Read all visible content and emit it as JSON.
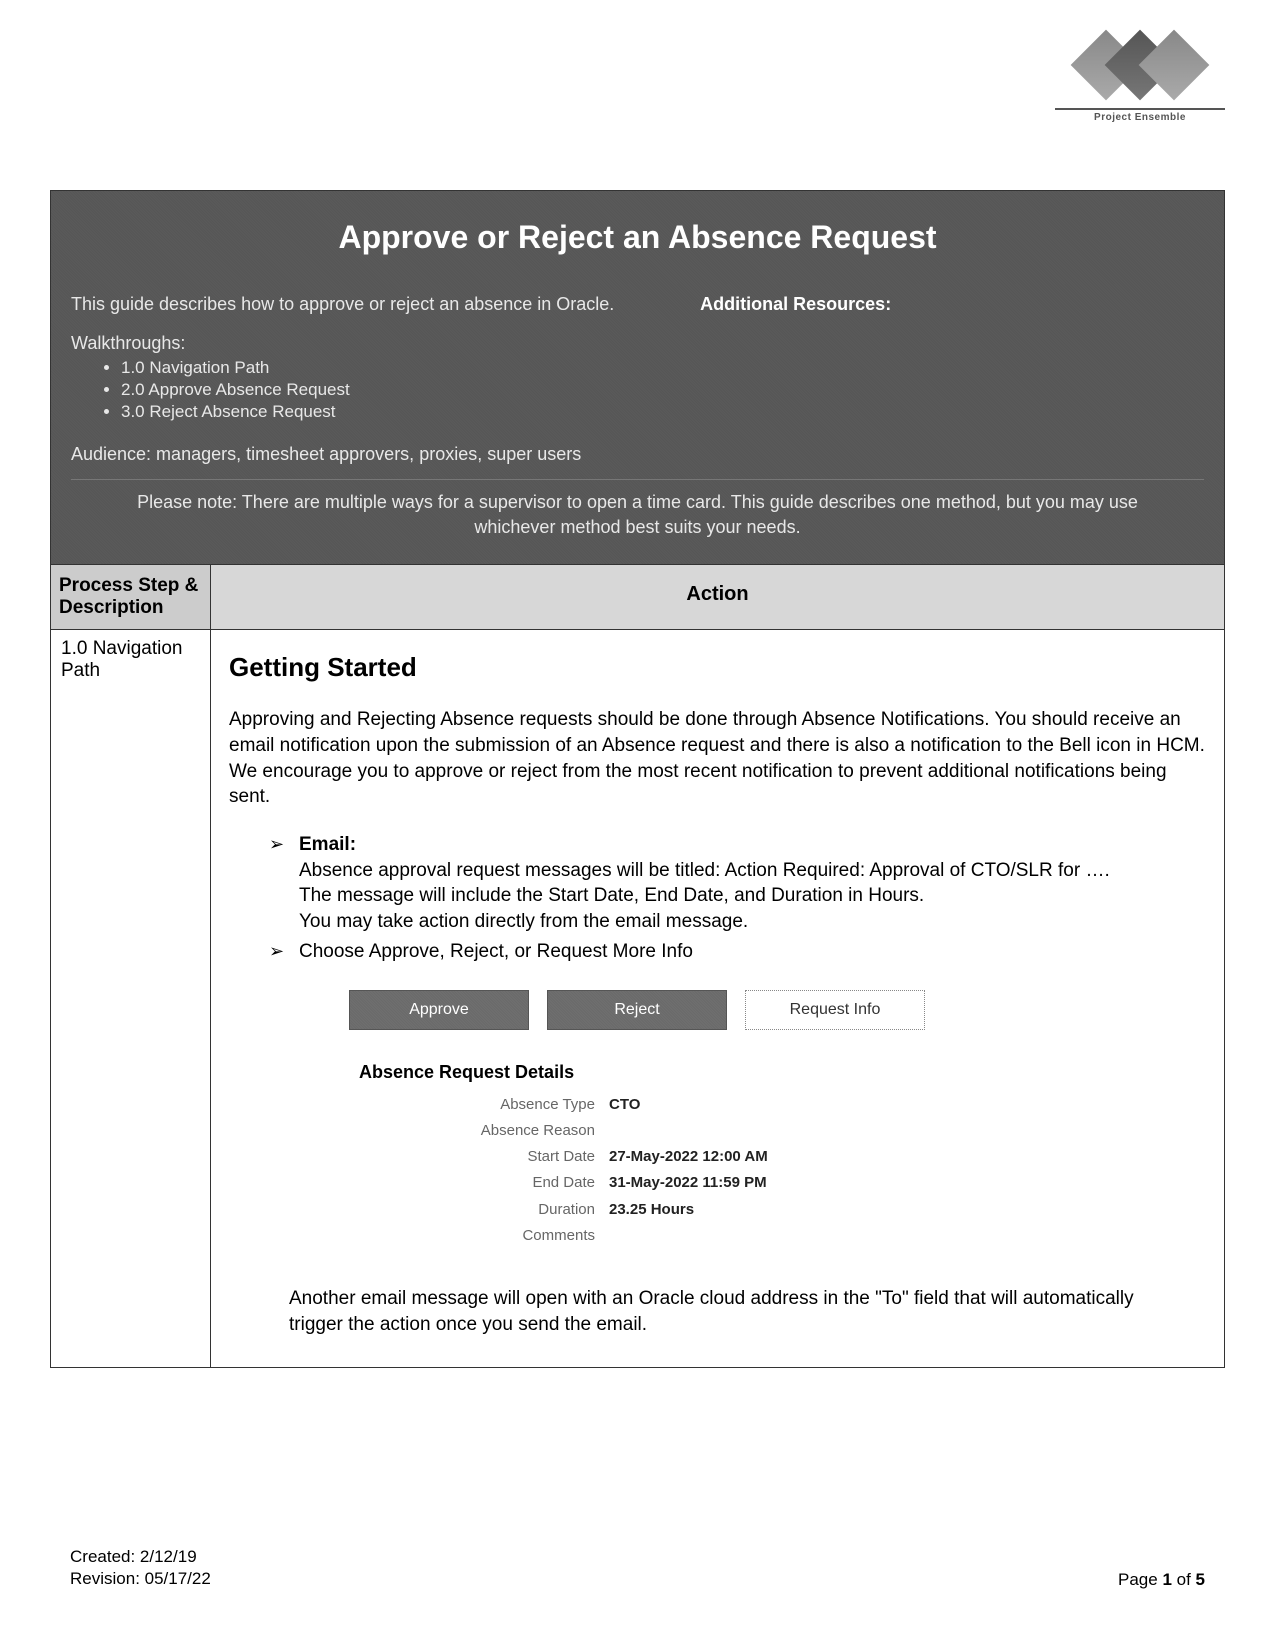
{
  "logo": {
    "caption": "Project Ensemble"
  },
  "title": "Approve or Reject an Absence Request",
  "intro": {
    "desc": "This guide describes how to approve or reject an absence in Oracle.",
    "walk_title": "Walkthroughs:",
    "walkthroughs": [
      "1.0 Navigation Path",
      "2.0 Approve Absence Request",
      "3.0 Reject Absence Request"
    ],
    "audience": "Audience: managers, timesheet approvers, proxies, super users",
    "resources_title": "Additional Resources:",
    "note": "Please note: There are multiple ways for a supervisor to open a time card. This guide describes one method, but you may use whichever method best suits your needs."
  },
  "table": {
    "header_left": "Process Step & Description",
    "header_right": "Action",
    "row1": {
      "step": "1.0 Navigation Path",
      "heading": "Getting Started",
      "para1": "Approving and Rejecting Absence requests should be done through Absence Notifications. You should receive an email notification upon the submission of an Absence request and there is also a notification to the Bell icon in HCM. We encourage you to approve or reject from the most recent notification to prevent additional notifications being sent.",
      "email_label": "Email:",
      "email_line1": "Absence approval request messages will be titled: Action Required: Approval of CTO/SLR for ….",
      "email_line2": "The message will include the Start Date, End Date, and Duration in Hours.",
      "email_line3": "You may take action directly from the email message.",
      "choose_line": "Choose Approve, Reject, or Request More Info",
      "buttons": {
        "approve": "Approve",
        "reject": "Reject",
        "info": "Request Info"
      },
      "details_title": "Absence Request Details",
      "details": [
        {
          "label": "Absence Type",
          "value": "CTO"
        },
        {
          "label": "Absence Reason",
          "value": ""
        },
        {
          "label": "Start Date",
          "value": "27-May-2022 12:00 AM"
        },
        {
          "label": "End Date",
          "value": "31-May-2022 11:59 PM"
        },
        {
          "label": "Duration",
          "value": "23.25 Hours"
        },
        {
          "label": "Comments",
          "value": ""
        }
      ],
      "after_para": "Another email message will open with an Oracle cloud address in the \"To\" field that will automatically trigger the action once you send the email."
    }
  },
  "footer": {
    "created": "Created: 2/12/19",
    "revision": "Revision: 05/17/22",
    "page_prefix": "Page ",
    "page_num": "1",
    "page_of": " of ",
    "page_total": "5"
  }
}
